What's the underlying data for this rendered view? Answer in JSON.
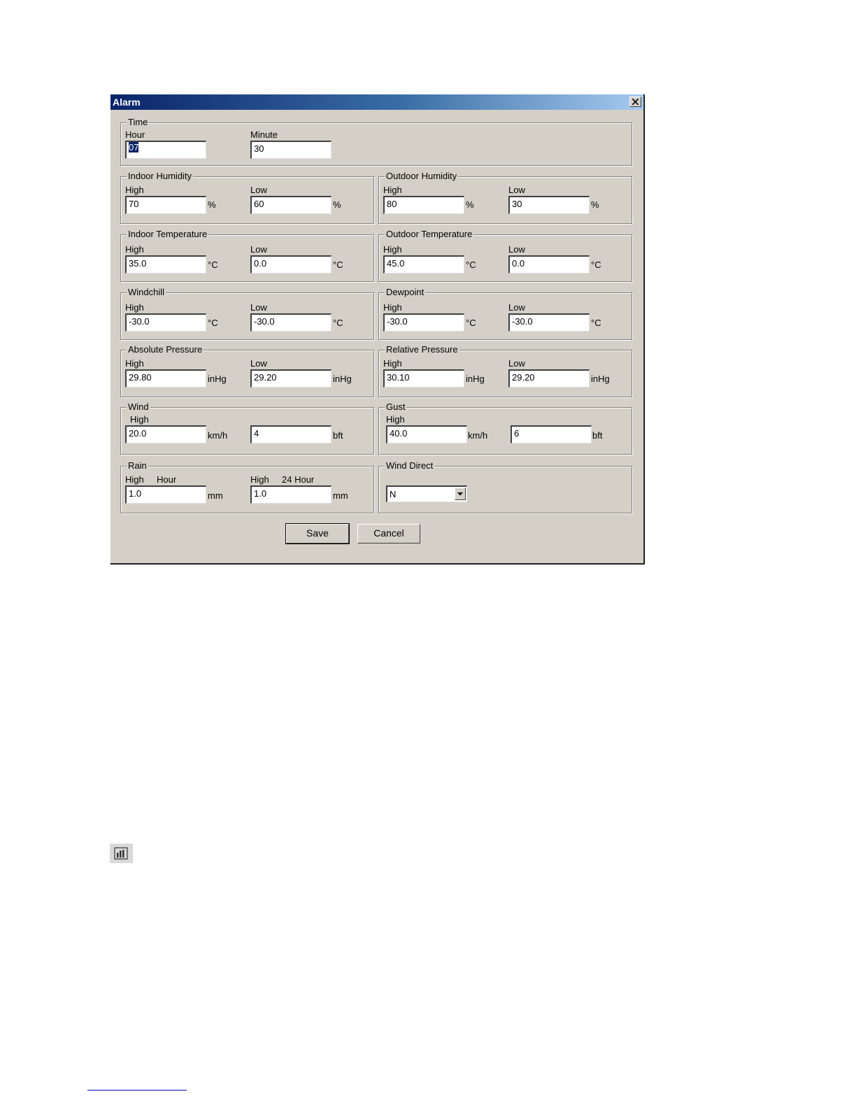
{
  "window": {
    "title": "Alarm",
    "close_icon": "close-icon"
  },
  "time": {
    "title": "Time",
    "hour_label": "Hour",
    "hour_value": "07",
    "minute_label": "Minute",
    "minute_value": "30"
  },
  "indoor_humidity": {
    "title": "Indoor Humidity",
    "high_label": "High",
    "high": "70",
    "low_label": "Low",
    "low": "60",
    "unit": "%"
  },
  "outdoor_humidity": {
    "title": "Outdoor Humidity",
    "high_label": "High",
    "high": "80",
    "low_label": "Low",
    "low": "30",
    "unit": "%"
  },
  "indoor_temperature": {
    "title": "Indoor Temperature",
    "high_label": "High",
    "high": "35.0",
    "low_label": "Low",
    "low": "0.0",
    "unit": "°C"
  },
  "outdoor_temperature": {
    "title": "Outdoor Temperature",
    "high_label": "High",
    "high": "45.0",
    "low_label": "Low",
    "low": "0.0",
    "unit": "°C"
  },
  "windchill": {
    "title": "Windchill",
    "high_label": "High",
    "high": "-30.0",
    "low_label": "Low",
    "low": "-30.0",
    "unit": "°C"
  },
  "dewpoint": {
    "title": "Dewpoint",
    "high_label": "High",
    "high": "-30.0",
    "low_label": "Low",
    "low": "-30.0",
    "unit": "°C"
  },
  "absolute_pressure": {
    "title": "Absolute Pressure",
    "high_label": "High",
    "high": "29.80",
    "low_label": "Low",
    "low": "29.20",
    "unit": "inHg"
  },
  "relative_pressure": {
    "title": "Relative Pressure",
    "high_label": "High",
    "high": "30.10",
    "low_label": "Low",
    "low": "29.20",
    "unit": "inHg"
  },
  "wind": {
    "title": "Wind",
    "high_label": "High",
    "speed": "20.0",
    "speed_unit": "km/h",
    "beaufort": "4",
    "beaufort_unit": "bft"
  },
  "gust": {
    "title": "Gust",
    "high_label": "High",
    "speed": "40.0",
    "speed_unit": "km/h",
    "beaufort": "6",
    "beaufort_unit": "bft"
  },
  "rain": {
    "title": "Rain",
    "hour_high_label": "High",
    "hour_label": "Hour",
    "hour_value": "1.0",
    "day_high_label": "High",
    "day_label": "24 Hour",
    "day_value": "1.0",
    "unit": "mm"
  },
  "wind_direction": {
    "title": "Wind Direct",
    "selected": "N"
  },
  "buttons": {
    "save": "Save",
    "cancel": "Cancel"
  },
  "page_icon": "bar-chart-icon"
}
